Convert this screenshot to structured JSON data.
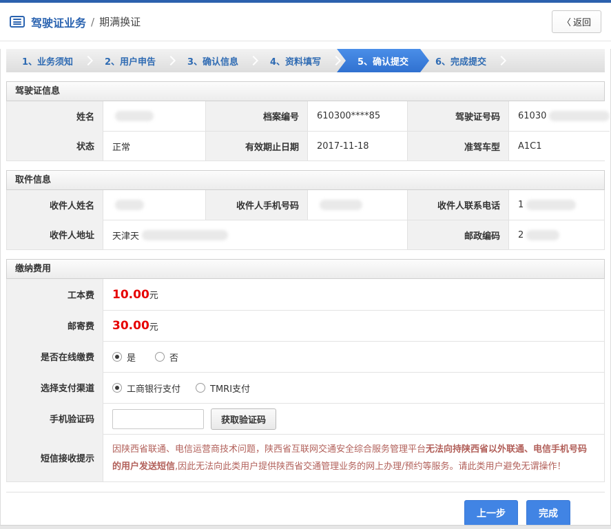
{
  "header": {
    "title": "驾驶证业务",
    "separator": "/",
    "subtitle": "期满换证",
    "back_chevron": "〈",
    "back_label": "返回"
  },
  "steps": [
    {
      "label": "1、业务须知",
      "active": false
    },
    {
      "label": "2、用户申告",
      "active": false
    },
    {
      "label": "3、确认信息",
      "active": false
    },
    {
      "label": "4、资料填写",
      "active": false
    },
    {
      "label": "5、确认提交",
      "active": true
    },
    {
      "label": "6、完成提交",
      "active": false
    }
  ],
  "license_section": {
    "title": "驾驶证信息",
    "fields": {
      "name": {
        "label": "姓名",
        "value": "",
        "redacted": true
      },
      "file_no": {
        "label": "档案编号",
        "value": "610300****85",
        "redacted": false
      },
      "license_no": {
        "label": "驾驶证号码",
        "value": "61030",
        "redacted": true
      },
      "status": {
        "label": "状态",
        "value": "正常",
        "redacted": false
      },
      "valid_until": {
        "label": "有效期止日期",
        "value": "2017-11-18",
        "redacted": false
      },
      "vehicle_class": {
        "label": "准驾车型",
        "value": "A1C1",
        "redacted": false
      }
    }
  },
  "pickup_section": {
    "title": "取件信息",
    "fields": {
      "recipient_name": {
        "label": "收件人姓名",
        "value": "",
        "redacted": true
      },
      "recipient_mobile": {
        "label": "收件人手机号码",
        "value": "",
        "redacted": true
      },
      "recipient_phone": {
        "label": "收件人联系电话",
        "value": "1",
        "redacted": true
      },
      "recipient_address": {
        "label": "收件人地址",
        "value": "天津天",
        "redacted": true
      },
      "postal_code": {
        "label": "邮政编码",
        "value": "2",
        "redacted": true
      }
    }
  },
  "payment_section": {
    "title": "缴纳费用",
    "fields": {
      "production_fee": {
        "label": "工本费",
        "amount": "10.00",
        "unit": "元"
      },
      "postage_fee": {
        "label": "邮寄费",
        "amount": "30.00",
        "unit": "元"
      },
      "online_payment": {
        "label": "是否在线缴费",
        "options": [
          {
            "label": "是",
            "checked": true
          },
          {
            "label": "否",
            "checked": false
          }
        ]
      },
      "payment_channel": {
        "label": "选择支付渠道",
        "options": [
          {
            "label": "工商银行支付",
            "checked": true
          },
          {
            "label": "TMRI支付",
            "checked": false
          }
        ]
      },
      "sms_code": {
        "label": "手机验证码",
        "input_value": "",
        "button_label": "获取验证码"
      },
      "sms_notice": {
        "label": "短信接收提示",
        "text_normal_1": "因陕西省联通、电信运营商技术问题，陕西省互联网交通安全综合服务管理平台",
        "text_bold": "无法向持陕西省以外联通、电信手机号码的用户发送短信",
        "text_normal_2": ",因此无法向此类用户提供陕西省交通管理业务的网上办理/预约等服务。请此类用户避免无谓操作！"
      }
    }
  },
  "footer": {
    "prev_label": "上一步",
    "finish_label": "完成"
  },
  "colors": {
    "accent_blue": "#2a63b0",
    "active_tab_blue": "#3d7fd9",
    "button_blue": "#4184e4",
    "fee_red": "#e60000",
    "notice_red": "#b2605a"
  }
}
